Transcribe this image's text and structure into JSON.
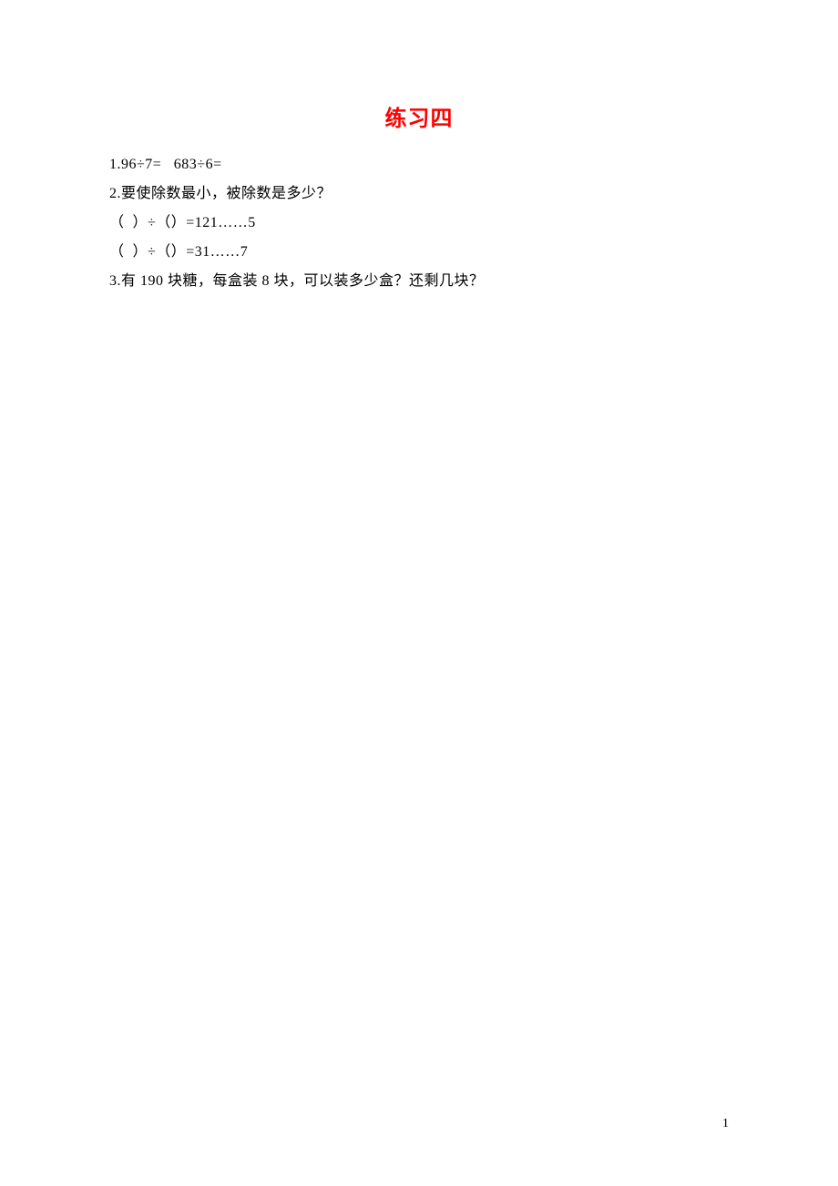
{
  "title": "练习四",
  "lines": {
    "q1": "1.96÷7=   683÷6=",
    "q2": "2.要使除数最小，被除数是多少？",
    "q2a": "（  ）÷（）=121……5",
    "q2b": "（  ）÷（）=31……7",
    "q3": "3.有 190 块糖，每盒装 8 块，可以装多少盒？还剩几块？"
  },
  "pageNumber": "1"
}
